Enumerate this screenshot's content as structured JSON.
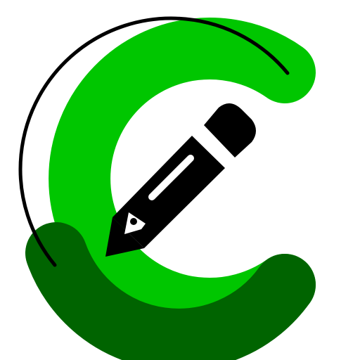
{
  "logo": {
    "icon": "pencil-edit-icon",
    "colors": {
      "ring_light_green": "#00c600",
      "ring_dark_green": "#006400",
      "inner_arc_black": "#000000",
      "pencil_black": "#000000",
      "pencil_highlight_white": "#ffffff",
      "background": "#ffffff"
    }
  }
}
